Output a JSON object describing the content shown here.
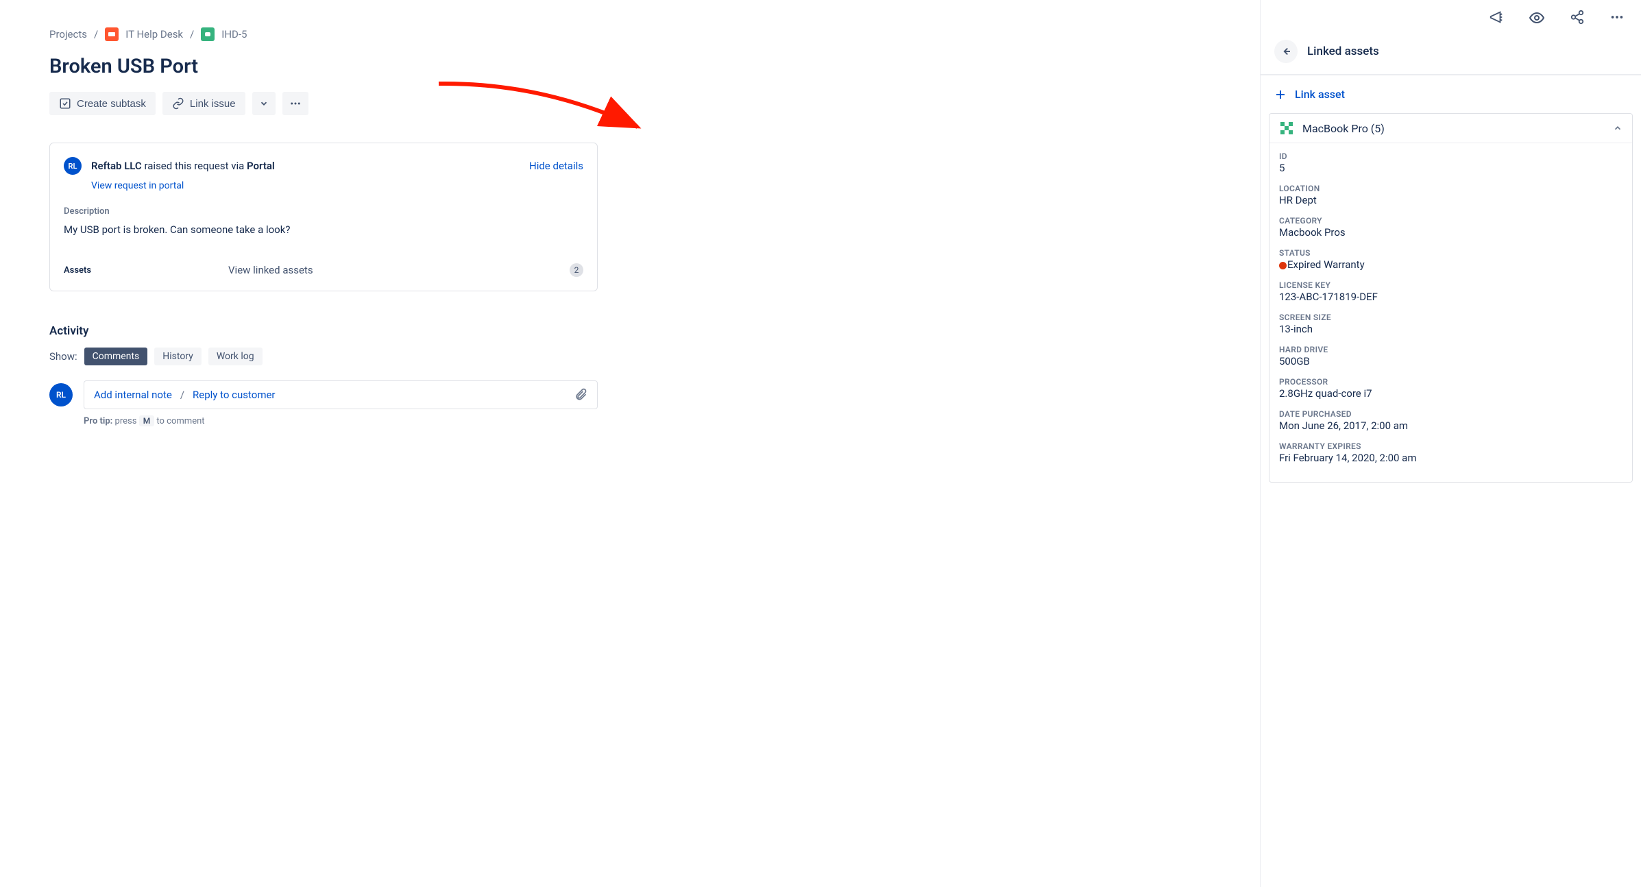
{
  "breadcrumb": {
    "projects": "Projects",
    "project_name": "IT Help Desk",
    "issue_key": "IHD-5"
  },
  "title": "Broken USB Port",
  "actions": {
    "create_subtask": "Create subtask",
    "link_issue": "Link issue"
  },
  "request": {
    "avatar": "RL",
    "reporter": "Reftab LLC",
    "raised_via_prefix": " raised this request via ",
    "raised_via": "Portal",
    "hide_details": "Hide details",
    "view_portal": "View request in portal",
    "description_label": "Description",
    "description_text": "My USB port is broken. Can someone take a look?",
    "assets_label": "Assets",
    "assets_action": "View linked assets",
    "assets_count": "2"
  },
  "activity": {
    "heading": "Activity",
    "show_label": "Show:",
    "tabs": {
      "comments": "Comments",
      "history": "History",
      "worklog": "Work log"
    },
    "add_note": "Add internal note",
    "reply": "Reply to customer",
    "protip_label": "Pro tip:",
    "protip_press": " press ",
    "protip_key": "M",
    "protip_rest": " to comment"
  },
  "sidebar": {
    "panel_title": "Linked assets",
    "link_asset": "Link asset",
    "asset_name": "MacBook Pro (5)",
    "fields": [
      {
        "label": "ID",
        "value": "5"
      },
      {
        "label": "LOCATION",
        "value": "HR Dept"
      },
      {
        "label": "CATEGORY",
        "value": "Macbook Pros"
      },
      {
        "label": "STATUS",
        "value": "Expired Warranty",
        "status": true
      },
      {
        "label": "LICENSE KEY",
        "value": "123-ABC-171819-DEF"
      },
      {
        "label": "SCREEN SIZE",
        "value": "13-inch"
      },
      {
        "label": "HARD DRIVE",
        "value": "500GB"
      },
      {
        "label": "PROCESSOR",
        "value": "2.8GHz quad-core i7"
      },
      {
        "label": "DATE PURCHASED",
        "value": "Mon June 26, 2017, 2:00 am"
      },
      {
        "label": "WARRANTY EXPIRES",
        "value": "Fri February 14, 2020, 2:00 am"
      }
    ]
  }
}
